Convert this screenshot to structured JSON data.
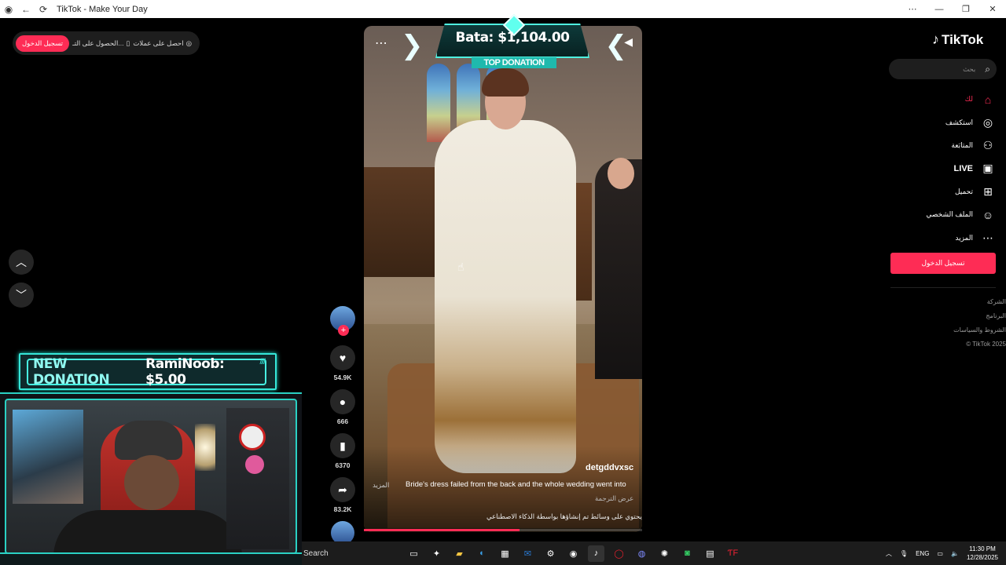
{
  "window": {
    "title": "TikTok - Make Your Day",
    "minimize": "—",
    "maximize": "❐",
    "close": "✕",
    "menu": "⋯"
  },
  "topbar": {
    "login_label": "تسجيل الدخول",
    "get_app": "الحصول على التـ...",
    "get_coins": "احصل على عملات"
  },
  "stream_overlay": {
    "donation_label": "NEW DONATION",
    "donation_value": "RamiNoob: $5.00",
    "top_donation_amount": "Bata: $1,104.00",
    "top_donation_label": "TOP DONATION"
  },
  "video": {
    "username": "detgddvxsc",
    "caption": "Bride's dress failed from the back and the whole wedding went into",
    "more_label": "المزيد",
    "translate_label": "عرض الترجمة",
    "ai_notice": "يحتوي على وسائط تم إنشاؤها بواسطة الذكاء الاصطناعي",
    "progress": 0.56
  },
  "actions": {
    "likes": "54.9K",
    "comments": "666",
    "saves": "6370",
    "shares": "83.2K"
  },
  "sidebar": {
    "logo_text": "TikTok",
    "search_placeholder": "بحث",
    "items": [
      {
        "label": "لك",
        "icon": "home-icon",
        "active": true
      },
      {
        "label": "استكشف",
        "icon": "compass-icon"
      },
      {
        "label": "المتابَعة",
        "icon": "following-icon"
      },
      {
        "label": "LIVE",
        "icon": "live-icon"
      },
      {
        "label": "تحميل",
        "icon": "upload-icon"
      },
      {
        "label": "الملف الشخصي",
        "icon": "profile-icon"
      },
      {
        "label": "المزيد",
        "icon": "more-icon"
      }
    ],
    "login_button": "تسجيل الدخول",
    "footer": [
      "الشركة",
      "البرنامج",
      "الشروط والسياسات",
      "© TikTok 2025"
    ]
  },
  "taskbar": {
    "search_label": "Search",
    "language": "ENG",
    "time": "11:30 PM",
    "date": "12/28/2025"
  },
  "colors": {
    "accent": "#fe2c55",
    "overlay_teal": "#36e6d8"
  }
}
